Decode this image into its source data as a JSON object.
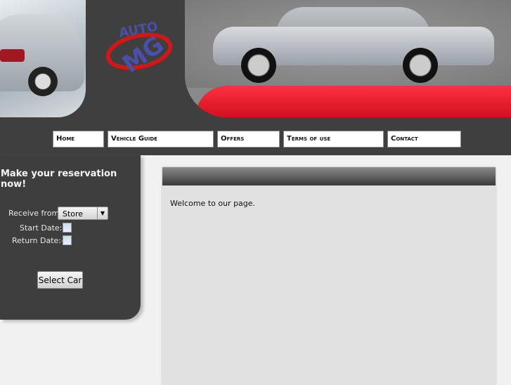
{
  "logo": {
    "text_top": "AUTO",
    "text_main": "MG"
  },
  "nav": [
    "Home",
    "Vehicle Guide",
    "Offers",
    "Terms of use",
    "Contact"
  ],
  "sidebar": {
    "title": "Make your reservation now!",
    "receive_label": "Receive from:",
    "receive_value": "Store",
    "start_label": "Start Date:-",
    "return_label": "Return Date:-",
    "button": "Select Car"
  },
  "main": {
    "welcome": "Welcome to our page."
  }
}
